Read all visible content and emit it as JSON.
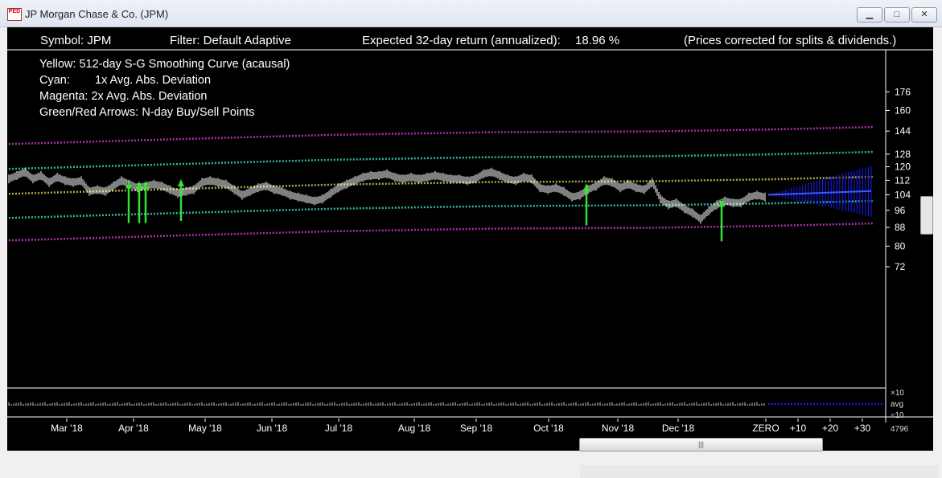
{
  "window": {
    "title": "JP Morgan Chase & Co. (JPM)",
    "icon": "chart-app-icon",
    "icon_text": "PED"
  },
  "header": {
    "symbol": "Symbol: JPM",
    "filter": "Filter: Default Adaptive",
    "expected_label": "Expected 32-day return (annualized):",
    "expected_value": "18.96 %",
    "note": "(Prices corrected for splits & dividends.)"
  },
  "legend": {
    "yellow": "Yellow: 512-day S-G Smoothing Curve (acausal)",
    "cyan_label": "Cyan:",
    "cyan_text": "1x Avg. Abs. Deviation",
    "magenta": "Magenta: 2x Avg. Abs. Deviation",
    "arrows": "Green/Red Arrows: N-day Buy/Sell Points"
  },
  "chart_data": {
    "type": "line",
    "yticks": [
      176,
      160,
      144,
      128,
      120,
      112,
      104,
      96,
      88,
      80,
      72
    ],
    "xticks": [
      "Mar '18",
      "Apr '18",
      "May '18",
      "Jun '18",
      "Jul '18",
      "Aug '18",
      "Sep '18",
      "Oct '18",
      "Nov '18",
      "Dec '18",
      "ZERO",
      "+10",
      "+20",
      "+30"
    ],
    "ylim": [
      70,
      182
    ],
    "log_scale": true,
    "colors": {
      "price": "#ffffff",
      "smooth": "#b5a642",
      "dev1": "#33b3a8",
      "dev2": "#b030b0",
      "forecast": "#1a1aff",
      "buy_arrow": "#33e033"
    },
    "price_series": [
      {
        "x": 0,
        "y": 113
      },
      {
        "x": 10,
        "y": 115
      },
      {
        "x": 20,
        "y": 117
      },
      {
        "x": 30,
        "y": 113
      },
      {
        "x": 40,
        "y": 115
      },
      {
        "x": 50,
        "y": 111
      },
      {
        "x": 60,
        "y": 114
      },
      {
        "x": 70,
        "y": 112
      },
      {
        "x": 80,
        "y": 111
      },
      {
        "x": 90,
        "y": 112
      },
      {
        "x": 100,
        "y": 106
      },
      {
        "x": 110,
        "y": 107
      },
      {
        "x": 120,
        "y": 106
      },
      {
        "x": 130,
        "y": 109
      },
      {
        "x": 140,
        "y": 112
      },
      {
        "x": 150,
        "y": 110
      },
      {
        "x": 160,
        "y": 108
      },
      {
        "x": 170,
        "y": 109
      },
      {
        "x": 180,
        "y": 110
      },
      {
        "x": 190,
        "y": 109
      },
      {
        "x": 200,
        "y": 107
      },
      {
        "x": 210,
        "y": 105
      },
      {
        "x": 220,
        "y": 106
      },
      {
        "x": 230,
        "y": 107
      },
      {
        "x": 240,
        "y": 111
      },
      {
        "x": 250,
        "y": 112
      },
      {
        "x": 260,
        "y": 111
      },
      {
        "x": 270,
        "y": 110
      },
      {
        "x": 280,
        "y": 107
      },
      {
        "x": 290,
        "y": 104
      },
      {
        "x": 300,
        "y": 106
      },
      {
        "x": 310,
        "y": 108
      },
      {
        "x": 320,
        "y": 109
      },
      {
        "x": 330,
        "y": 107
      },
      {
        "x": 340,
        "y": 106
      },
      {
        "x": 350,
        "y": 104
      },
      {
        "x": 360,
        "y": 103
      },
      {
        "x": 370,
        "y": 102
      },
      {
        "x": 380,
        "y": 101
      },
      {
        "x": 390,
        "y": 102
      },
      {
        "x": 400,
        "y": 105
      },
      {
        "x": 410,
        "y": 108
      },
      {
        "x": 420,
        "y": 110
      },
      {
        "x": 430,
        "y": 112
      },
      {
        "x": 440,
        "y": 114
      },
      {
        "x": 450,
        "y": 115
      },
      {
        "x": 460,
        "y": 115
      },
      {
        "x": 470,
        "y": 116
      },
      {
        "x": 480,
        "y": 114
      },
      {
        "x": 490,
        "y": 113
      },
      {
        "x": 500,
        "y": 114
      },
      {
        "x": 510,
        "y": 113
      },
      {
        "x": 520,
        "y": 114
      },
      {
        "x": 530,
        "y": 115
      },
      {
        "x": 540,
        "y": 114
      },
      {
        "x": 550,
        "y": 113
      },
      {
        "x": 560,
        "y": 113
      },
      {
        "x": 570,
        "y": 112
      },
      {
        "x": 580,
        "y": 113
      },
      {
        "x": 590,
        "y": 116
      },
      {
        "x": 600,
        "y": 117
      },
      {
        "x": 610,
        "y": 115
      },
      {
        "x": 620,
        "y": 113
      },
      {
        "x": 630,
        "y": 112
      },
      {
        "x": 640,
        "y": 114
      },
      {
        "x": 650,
        "y": 113
      },
      {
        "x": 660,
        "y": 108
      },
      {
        "x": 670,
        "y": 107
      },
      {
        "x": 680,
        "y": 108
      },
      {
        "x": 690,
        "y": 106
      },
      {
        "x": 700,
        "y": 103
      },
      {
        "x": 710,
        "y": 104
      },
      {
        "x": 720,
        "y": 107
      },
      {
        "x": 730,
        "y": 109
      },
      {
        "x": 740,
        "y": 112
      },
      {
        "x": 750,
        "y": 111
      },
      {
        "x": 760,
        "y": 108
      },
      {
        "x": 770,
        "y": 110
      },
      {
        "x": 780,
        "y": 108
      },
      {
        "x": 790,
        "y": 107
      },
      {
        "x": 800,
        "y": 111
      },
      {
        "x": 810,
        "y": 102
      },
      {
        "x": 820,
        "y": 99
      },
      {
        "x": 830,
        "y": 100
      },
      {
        "x": 840,
        "y": 97
      },
      {
        "x": 850,
        "y": 95
      },
      {
        "x": 860,
        "y": 92
      },
      {
        "x": 870,
        "y": 96
      },
      {
        "x": 880,
        "y": 99
      },
      {
        "x": 890,
        "y": 101
      },
      {
        "x": 900,
        "y": 100
      },
      {
        "x": 910,
        "y": 100
      },
      {
        "x": 920,
        "y": 103
      },
      {
        "x": 930,
        "y": 104
      },
      {
        "x": 940,
        "y": 103
      }
    ],
    "smoothing_curve": [
      {
        "x": 0,
        "y": 104.5
      },
      {
        "x": 200,
        "y": 107
      },
      {
        "x": 400,
        "y": 109.5
      },
      {
        "x": 600,
        "y": 111
      },
      {
        "x": 800,
        "y": 111.5
      },
      {
        "x": 940,
        "y": 112.5
      },
      {
        "x": 1075,
        "y": 114
      }
    ],
    "buy_arrows": [
      {
        "x": 149,
        "y": 90
      },
      {
        "x": 162,
        "y": 90
      },
      {
        "x": 170,
        "y": 90
      },
      {
        "x": 214,
        "y": 91
      },
      {
        "x": 718,
        "y": 89
      },
      {
        "x": 886,
        "y": 82
      }
    ],
    "forecast": {
      "x_start": 944,
      "x_end": 1072,
      "center_start": 104,
      "center_end": 106,
      "upper_end": 120.5,
      "lower_end": 93
    }
  },
  "lower_panel": {
    "label_top": "×10",
    "label_mid": "avg",
    "label_bot": "÷10",
    "count": "4796"
  }
}
